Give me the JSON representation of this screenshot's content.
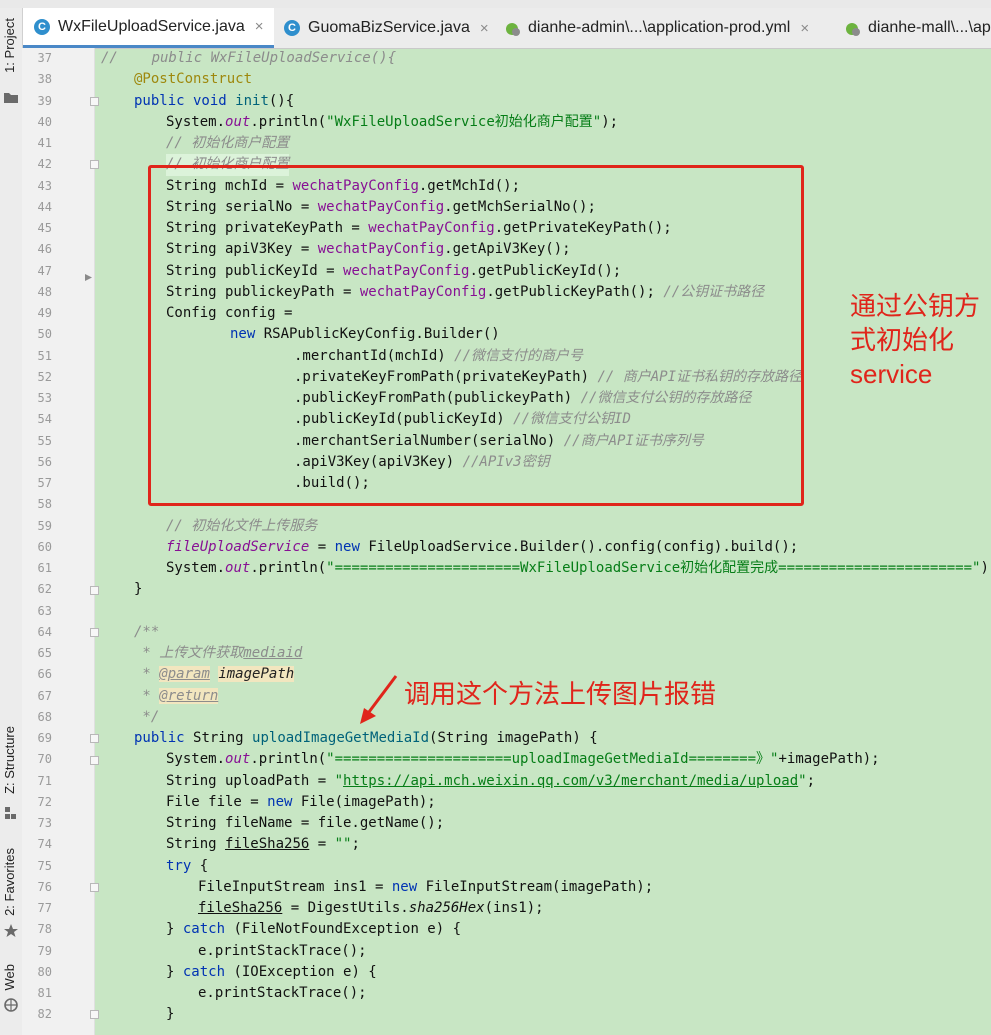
{
  "tabs": [
    {
      "label": "WxFileUploadService.java",
      "icon": "class-icon",
      "active": true
    },
    {
      "label": "GuomaBizService.java",
      "icon": "class-icon",
      "active": false
    },
    {
      "label": "dianhe-admin\\...\\application-prod.yml",
      "icon": "spring-leaf-icon",
      "active": false
    },
    {
      "label": "dianhe-mall\\...\\ap",
      "icon": "spring-leaf-icon",
      "active": false
    }
  ],
  "tab_close": "×",
  "sidebar": {
    "project": "1: Project",
    "structure": "Z: Structure",
    "favorites": "2: Favorites",
    "web": "Web"
  },
  "editor": {
    "line_numbers": [
      "37",
      "38",
      "39",
      "40",
      "41",
      "42",
      "43",
      "44",
      "45",
      "46",
      "47",
      "48",
      "49",
      "50",
      "51",
      "52",
      "53",
      "54",
      "55",
      "56",
      "57",
      "58",
      "59",
      "60",
      "61",
      "62",
      "63",
      "64",
      "65",
      "66",
      "67",
      "68",
      "69",
      "70",
      "71",
      "72",
      "73",
      "74",
      "75",
      "76",
      "77",
      "78",
      "79",
      "80",
      "81",
      "82"
    ],
    "code": {
      "l37": "//    public WxFileUploadService(){",
      "l38a": "@PostConstruct",
      "l39a": "public void ",
      "l39b": "init",
      "l39c": "(){",
      "l40a": "System.",
      "l40b": "out",
      "l40c": ".println(",
      "l40d": "\"WxFileUploadService初始化商户配置\"",
      "l40e": ");",
      "l41": "// 初始化商户配置",
      "l42": "// 初始化商户配置",
      "l43a": "String mchId = ",
      "l43b": "wechatPayConfig",
      "l43c": ".getMchId();",
      "l44a": "String serialNo = ",
      "l44b": "wechatPayConfig",
      "l44c": ".getMchSerialNo();",
      "l45a": "String privateKeyPath = ",
      "l45b": "wechatPayConfig",
      "l45c": ".getPrivateKeyPath();",
      "l46a": "String apiV3Key = ",
      "l46b": "wechatPayConfig",
      "l46c": ".getApiV3Key();",
      "l47a": "String publicKeyId = ",
      "l47b": "wechatPayConfig",
      "l47c": ".getPublicKeyId();",
      "l48a": "String publickeyPath = ",
      "l48b": "wechatPayConfig",
      "l48c": ".getPublicKeyPath(); ",
      "l48d": "//公钥证书路径",
      "l49": "Config config =",
      "l50a": "new ",
      "l50b": "RSAPublicKeyConfig.Builder()",
      "l51a": ".merchantId(mchId) ",
      "l51b": "//微信支付的商户号",
      "l52a": ".privateKeyFromPath(privateKeyPath) ",
      "l52b": "// 商户API证书私钥的存放路径",
      "l53a": ".publicKeyFromPath(publickeyPath) ",
      "l53b": "//微信支付公钥的存放路径",
      "l54a": ".publicKeyId(publicKeyId) ",
      "l54b": "//微信支付公钥ID",
      "l55a": ".merchantSerialNumber(serialNo) ",
      "l55b": "//商户API证书序列号",
      "l56a": ".apiV3Key(apiV3Key) ",
      "l56b": "//APIv3密钥",
      "l57": ".build();",
      "l59": "// 初始化文件上传服务",
      "l60a": "fileUploadService",
      "l60b": " = ",
      "l60c": "new ",
      "l60d": "FileUploadService.Builder().config(config).build();",
      "l61a": "System.",
      "l61b": "out",
      "l61c": ".println(",
      "l61d": "\"======================WxFileUploadService初始化配置完成=======================\"",
      "l61e": ");",
      "l62": "}",
      "l64": "/**",
      "l65a": " * 上传文件获取",
      "l65b": "mediaid",
      "l66a": " * ",
      "l66b": "@param",
      "l66c": " ",
      "l66d": "imagePath",
      "l67a": " * ",
      "l67b": "@return",
      "l68": " */",
      "l69a": "public ",
      "l69b": "String ",
      "l69c": "uploadImageGetMediaId",
      "l69d": "(String imagePath) {",
      "l70a": "System.",
      "l70b": "out",
      "l70c": ".println(",
      "l70d": "\"=====================uploadImageGetMediaId========》\"",
      "l70e": "+imagePath);",
      "l71a": "String uploadPath = ",
      "l71b": "\"",
      "l71c": "https://api.mch.weixin.qq.com/v3/merchant/media/upload",
      "l71d": "\"",
      "l71e": ";",
      "l72a": "File file = ",
      "l72b": "new ",
      "l72c": "File(imagePath);",
      "l73": "String fileName = file.getName();",
      "l74a": "String ",
      "l74b": "fileSha256",
      "l74c": " = ",
      "l74d": "\"\"",
      "l74e": ";",
      "l75a": "try ",
      "l75b": "{",
      "l76a": "FileInputStream ins1 = ",
      "l76b": "new ",
      "l76c": "FileInputStream(imagePath);",
      "l77a": "fileSha256",
      "l77b": " = DigestUtils.",
      "l77c": "sha256Hex",
      "l77d": "(ins1);",
      "l78a": "} ",
      "l78b": "catch ",
      "l78c": "(FileNotFoundException e) {",
      "l79": "e.printStackTrace();",
      "l80a": "} ",
      "l80b": "catch ",
      "l80c": "(IOException e) {",
      "l81": "e.printStackTrace();",
      "l82": "}"
    }
  },
  "annotations": {
    "box_note": [
      "通过公钥方",
      "式初始化",
      "service"
    ],
    "arrow_note": "调用这个方法上传图片报错"
  },
  "colors": {
    "highlight_box": "#e0251b",
    "editor_background": "#c8e6c4",
    "active_tab_underline": "#4a88c7"
  }
}
